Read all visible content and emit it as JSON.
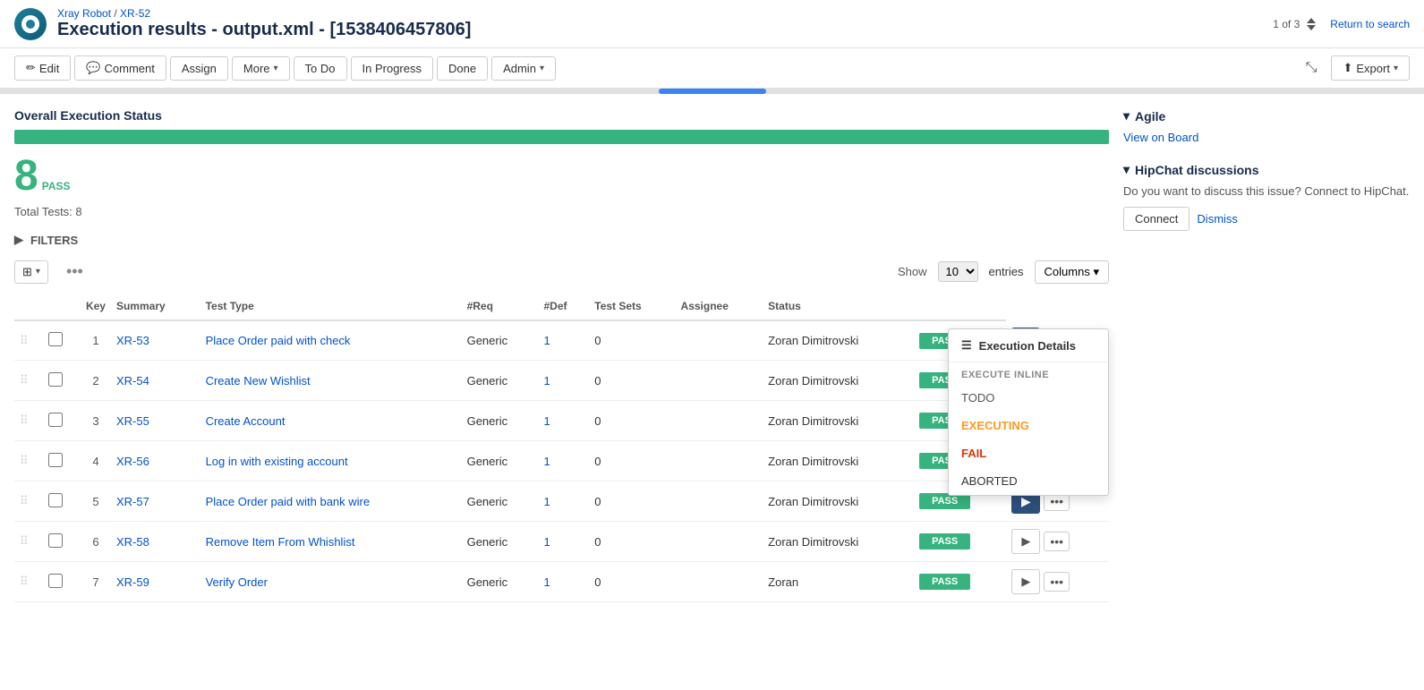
{
  "header": {
    "breadcrumb_project": "Xray Robot",
    "breadcrumb_separator": "/",
    "breadcrumb_issue": "XR-52",
    "title": "Execution results - output.xml - [1538406457806]",
    "pagination": "1 of 3",
    "return_link": "Return to search"
  },
  "toolbar": {
    "edit": "Edit",
    "comment": "Comment",
    "assign": "Assign",
    "more": "More",
    "todo": "To Do",
    "in_progress": "In Progress",
    "done": "Done",
    "admin": "Admin",
    "export": "Export"
  },
  "status_section": {
    "title": "Overall Execution Status",
    "pass_count": "8",
    "pass_label": "PASS",
    "total_tests": "Total Tests: 8",
    "progress_percent": 100
  },
  "filters": {
    "label": "FILTERS"
  },
  "table": {
    "show_label": "Show",
    "show_value": "10",
    "entries_label": "entries",
    "columns_label": "Columns",
    "headers": [
      "",
      "",
      "Key",
      "Summary",
      "Test Type",
      "#Req",
      "#Def",
      "Test Sets",
      "Assignee",
      "Status",
      ""
    ],
    "rows": [
      {
        "num": "1",
        "key": "XR-53",
        "summary": "Place Order paid with check",
        "type": "Generic",
        "req": "1",
        "def": "0",
        "sets": "",
        "assignee": "Zoran Dimitrovski",
        "status": "PASS",
        "active": true
      },
      {
        "num": "2",
        "key": "XR-54",
        "summary": "Create New Wishlist",
        "type": "Generic",
        "req": "1",
        "def": "0",
        "sets": "",
        "assignee": "Zoran Dimitrovski",
        "status": "PASS",
        "active": false
      },
      {
        "num": "3",
        "key": "XR-55",
        "summary": "Create Account",
        "type": "Generic",
        "req": "1",
        "def": "0",
        "sets": "",
        "assignee": "Zoran Dimitrovski",
        "status": "PASS",
        "active": false
      },
      {
        "num": "4",
        "key": "XR-56",
        "summary": "Log in with existing account",
        "type": "Generic",
        "req": "1",
        "def": "0",
        "sets": "",
        "assignee": "Zoran Dimitrovski",
        "status": "PASS",
        "active": false
      },
      {
        "num": "5",
        "key": "XR-57",
        "summary": "Place Order paid with bank wire",
        "type": "Generic",
        "req": "1",
        "def": "0",
        "sets": "",
        "assignee": "Zoran Dimitrovski",
        "status": "PASS",
        "active": false
      },
      {
        "num": "6",
        "key": "XR-58",
        "summary": "Remove Item From Whishlist",
        "type": "Generic",
        "req": "1",
        "def": "0",
        "sets": "",
        "assignee": "Zoran Dimitrovski",
        "status": "PASS",
        "active": false
      },
      {
        "num": "7",
        "key": "XR-59",
        "summary": "Verify Order",
        "type": "Generic",
        "req": "1",
        "def": "0",
        "sets": "",
        "assignee": "Zoran",
        "status": "PASS",
        "active": false
      }
    ]
  },
  "dropdown_menu": {
    "header": "Execution Details",
    "section_label": "EXECUTE INLINE",
    "items": [
      {
        "label": "TODO",
        "style": "todo"
      },
      {
        "label": "EXECUTING",
        "style": "executing"
      },
      {
        "label": "FAIL",
        "style": "fail"
      },
      {
        "label": "ABORTED",
        "style": "aborted"
      }
    ]
  },
  "right_panel": {
    "agile_title": "Agile",
    "view_on_board": "View on Board",
    "hipchat_title": "HipChat discussions",
    "hipchat_text": "Do you want to discuss this issue? Connect to HipChat.",
    "connect_btn": "Connect",
    "dismiss_btn": "Dismiss"
  }
}
